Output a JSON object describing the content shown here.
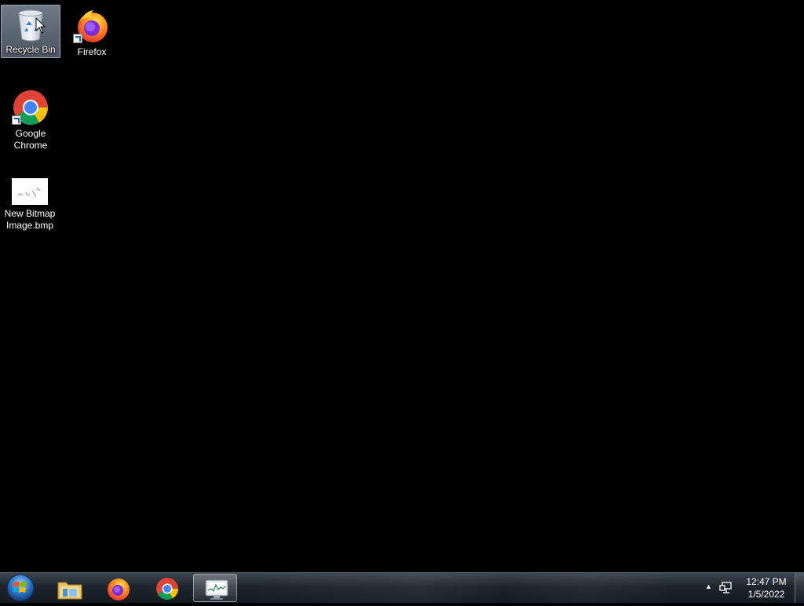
{
  "desktop": {
    "background_color": "#000000",
    "icons": [
      {
        "label": "Recycle Bin",
        "icon": "recycle-bin-icon",
        "selected": true
      },
      {
        "label": "Firefox",
        "icon": "firefox-icon",
        "shortcut": true
      },
      {
        "label": "Google Chrome",
        "icon": "chrome-icon",
        "shortcut": true
      },
      {
        "label": "New Bitmap Image.bmp",
        "icon": "bitmap-image-icon"
      }
    ]
  },
  "taskbar": {
    "start": {
      "icon": "windows-start-orb-icon"
    },
    "pinned": [
      {
        "icon": "file-explorer-icon"
      },
      {
        "icon": "firefox-icon"
      },
      {
        "icon": "chrome-icon"
      },
      {
        "icon": "resource-monitor-icon",
        "active": true
      }
    ],
    "tray": {
      "show_hidden_icon": "up-arrow-icon",
      "network_icon": "network-icon",
      "time": "12:47 PM",
      "date": "1/5/2022"
    }
  }
}
